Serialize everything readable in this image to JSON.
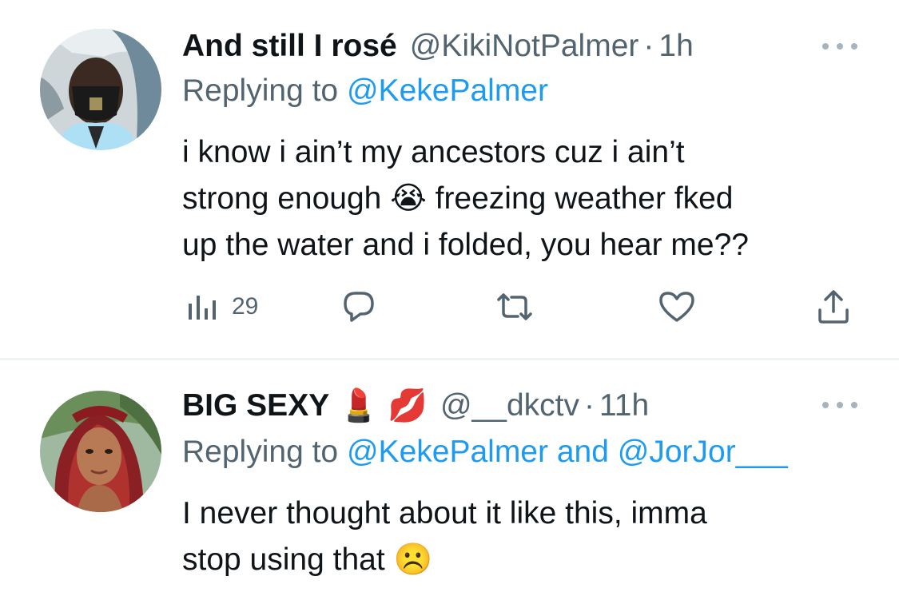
{
  "tweets": [
    {
      "display_name": "And still I rosé",
      "name_emojis": "",
      "handle": "@KikiNotPalmer",
      "separator": "·",
      "time": "1h",
      "replying_prefix": "Replying to",
      "replying_to": "@KekePalmer",
      "replying_and": "",
      "replying_to_2": "",
      "body_lines": [
        "i know i ain’t my ancestors cuz i ain’t",
        "strong enough 😭 freezing weather fked",
        "up the water and i folded, you hear me??"
      ],
      "views": "29",
      "avatar": "person wearing mask in car"
    },
    {
      "display_name": "BIG SEXY",
      "name_emojis": "💄 💋",
      "handle": "@__dkctv",
      "separator": "·",
      "time": "11h",
      "replying_prefix": "Replying to",
      "replying_to": "@KekePalmer",
      "replying_and": "and",
      "replying_to_2": "@JorJor___",
      "body_lines": [
        "I never thought about it like this, imma",
        "stop using that ☹️"
      ],
      "avatar": "woman with red hair outdoors"
    }
  ],
  "colors": {
    "text_primary": "#0f1419",
    "text_secondary": "#536471",
    "link": "#1d9bf0",
    "divider": "#eff3f4"
  },
  "icons": [
    "views-icon",
    "reply-icon",
    "retweet-icon",
    "like-icon",
    "share-icon",
    "more-icon"
  ]
}
